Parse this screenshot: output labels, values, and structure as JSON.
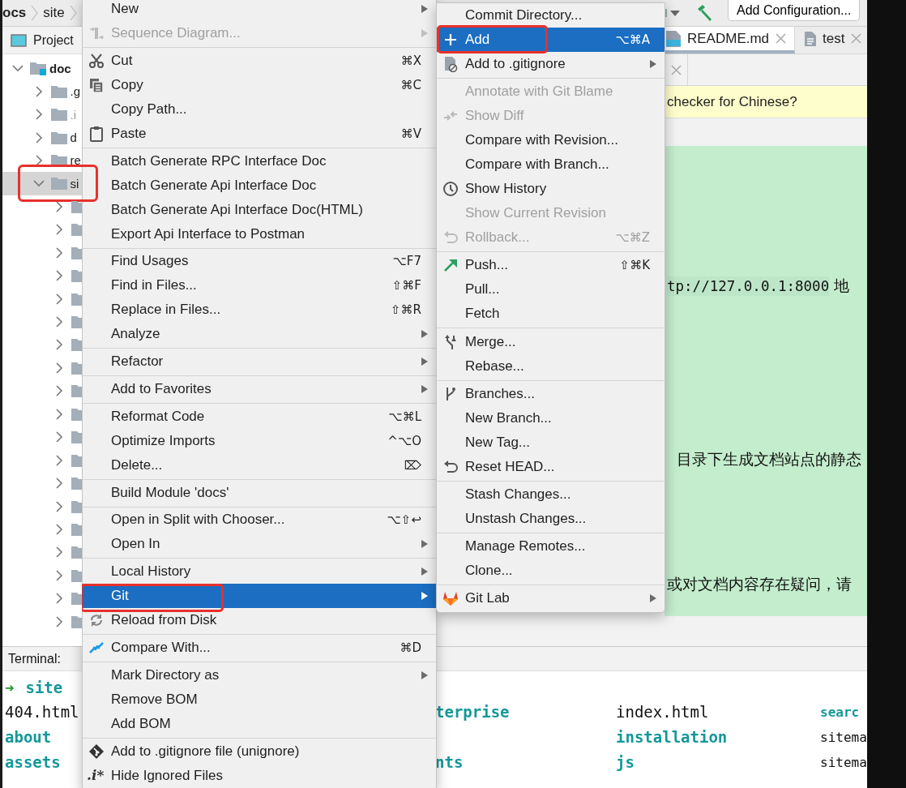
{
  "breadcrumbs": [
    {
      "label": "ocs",
      "bold": true
    },
    {
      "label": "site",
      "bold": false
    }
  ],
  "toolbar": {
    "button": "Add Configuration..."
  },
  "project_panel": {
    "title": "Project"
  },
  "tree": {
    "label": "doc",
    "expanded": true,
    "selected": false,
    "highlighted": false,
    "children": [
      {
        "label": ".g",
        "expanded": false,
        "selected": false,
        "highlighted": false,
        "ignored": false
      },
      {
        "label": ".i",
        "expanded": false,
        "selected": false,
        "highlighted": false,
        "ignored": true
      },
      {
        "label": "d",
        "expanded": false,
        "selected": false,
        "highlighted": false,
        "ignored": false
      },
      {
        "label": "re",
        "expanded": false,
        "selected": false,
        "highlighted": false,
        "ignored": false
      },
      {
        "label": "si",
        "expanded": true,
        "selected": true,
        "highlighted": true,
        "ignored": false,
        "children": [
          {
            "expanded": false,
            "selected": false
          },
          {
            "expanded": false,
            "selected": false
          },
          {
            "expanded": false,
            "selected": false
          },
          {
            "expanded": false,
            "selected": false
          },
          {
            "expanded": false,
            "selected": false
          },
          {
            "expanded": false,
            "selected": false
          },
          {
            "expanded": false,
            "selected": false
          },
          {
            "expanded": false,
            "selected": false
          },
          {
            "expanded": false,
            "selected": false
          },
          {
            "expanded": false,
            "selected": false
          },
          {
            "expanded": false,
            "selected": false
          },
          {
            "expanded": false,
            "selected": false
          },
          {
            "expanded": false,
            "selected": false
          },
          {
            "expanded": false,
            "selected": false
          },
          {
            "expanded": false,
            "selected": false
          },
          {
            "expanded": false,
            "selected": false
          },
          {
            "expanded": false,
            "selected": false
          },
          {
            "expanded": false,
            "selected": false
          },
          {
            "expanded": false,
            "selected": false
          }
        ]
      }
    ]
  },
  "editor": {
    "tabs": [
      {
        "label": "README.md",
        "kind": "markdown",
        "selected": true
      },
      {
        "label": "test",
        "kind": "text",
        "selected": false
      }
    ],
    "notification": "checker for Chinese?",
    "lines": [
      {
        "kind": "code",
        "code": "tp://127.0.0.1:8000",
        "text": "地"
      },
      {
        "kind": "text",
        "text": "目录下生成文档站点的静态"
      },
      {
        "kind": "text",
        "text": "或对文档内容存在疑问，请"
      }
    ]
  },
  "terminal": {
    "title": "Terminal:",
    "prompt_arrow": "➜",
    "prompt_dir": "site",
    "columns": [
      [
        {
          "text": "404.html",
          "kind": "file"
        },
        {
          "text": "about",
          "kind": "dir"
        },
        {
          "text": "assets",
          "kind": "dir"
        }
      ],
      [
        {
          "text": "terprise",
          "kind": "dir"
        },
        {
          "text": "nts",
          "kind": "dir"
        }
      ],
      [
        {
          "text": "index.html",
          "kind": "file"
        },
        {
          "text": "installation",
          "kind": "dir"
        },
        {
          "text": "js",
          "kind": "dir"
        }
      ],
      [
        {
          "text": "searc",
          "kind": "dir"
        },
        {
          "text": "sitema",
          "kind": "file"
        },
        {
          "text": "sitema",
          "kind": "file"
        }
      ]
    ]
  },
  "context_menu": {
    "items": [
      {
        "kind": "item",
        "label": "New",
        "submenu": true,
        "disabled": false,
        "selected": false,
        "highlighted": false
      },
      {
        "kind": "item",
        "label": "Sequence Diagram...",
        "submenu": true,
        "disabled": true,
        "selected": false,
        "highlighted": false
      },
      {
        "kind": "separator"
      },
      {
        "kind": "item",
        "label": "Cut",
        "shortcut": "⌘X",
        "submenu": false,
        "disabled": false,
        "selected": false,
        "highlighted": false
      },
      {
        "kind": "item",
        "label": "Copy",
        "shortcut": "⌘C",
        "submenu": false,
        "disabled": false,
        "selected": false,
        "highlighted": false
      },
      {
        "kind": "item",
        "label": "Copy Path...",
        "submenu": false,
        "disabled": false,
        "selected": false,
        "highlighted": false
      },
      {
        "kind": "item",
        "label": "Paste",
        "shortcut": "⌘V",
        "submenu": false,
        "disabled": false,
        "selected": false,
        "highlighted": false
      },
      {
        "kind": "separator"
      },
      {
        "kind": "item",
        "label": "Batch Generate RPC Interface Doc",
        "submenu": false,
        "disabled": false,
        "selected": false,
        "highlighted": false
      },
      {
        "kind": "item",
        "label": "Batch Generate Api Interface Doc",
        "submenu": false,
        "disabled": false,
        "selected": false,
        "highlighted": false
      },
      {
        "kind": "item",
        "label": "Batch Generate Api Interface Doc(HTML)",
        "submenu": false,
        "disabled": false,
        "selected": false,
        "highlighted": false
      },
      {
        "kind": "item",
        "label": "Export Api Interface to Postman",
        "submenu": false,
        "disabled": false,
        "selected": false,
        "highlighted": false
      },
      {
        "kind": "separator"
      },
      {
        "kind": "item",
        "label": "Find Usages",
        "shortcut": "⌥F7",
        "submenu": false,
        "disabled": false,
        "selected": false,
        "highlighted": false
      },
      {
        "kind": "item",
        "label": "Find in Files...",
        "shortcut": "⇧⌘F",
        "submenu": false,
        "disabled": false,
        "selected": false,
        "highlighted": false
      },
      {
        "kind": "item",
        "label": "Replace in Files...",
        "shortcut": "⇧⌘R",
        "submenu": false,
        "disabled": false,
        "selected": false,
        "highlighted": false
      },
      {
        "kind": "item",
        "label": "Analyze",
        "submenu": true,
        "disabled": false,
        "selected": false,
        "highlighted": false
      },
      {
        "kind": "separator"
      },
      {
        "kind": "item",
        "label": "Refactor",
        "submenu": true,
        "disabled": false,
        "selected": false,
        "highlighted": false
      },
      {
        "kind": "separator"
      },
      {
        "kind": "item",
        "label": "Add to Favorites",
        "submenu": true,
        "disabled": false,
        "selected": false,
        "highlighted": false
      },
      {
        "kind": "separator"
      },
      {
        "kind": "item",
        "label": "Reformat Code",
        "shortcut": "⌥⌘L",
        "submenu": false,
        "disabled": false,
        "selected": false,
        "highlighted": false
      },
      {
        "kind": "item",
        "label": "Optimize Imports",
        "shortcut": "^⌥O",
        "submenu": false,
        "disabled": false,
        "selected": false,
        "highlighted": false
      },
      {
        "kind": "item",
        "label": "Delete...",
        "shortcut": "⌦",
        "submenu": false,
        "disabled": false,
        "selected": false,
        "highlighted": false
      },
      {
        "kind": "separator"
      },
      {
        "kind": "item",
        "label": "Build Module 'docs'",
        "submenu": false,
        "disabled": false,
        "selected": false,
        "highlighted": false
      },
      {
        "kind": "separator"
      },
      {
        "kind": "item",
        "label": "Open in Split with Chooser...",
        "shortcut": "⌥⇧↩",
        "submenu": false,
        "disabled": false,
        "selected": false,
        "highlighted": false
      },
      {
        "kind": "item",
        "label": "Open In",
        "submenu": true,
        "disabled": false,
        "selected": false,
        "highlighted": false
      },
      {
        "kind": "separator"
      },
      {
        "kind": "item",
        "label": "Local History",
        "submenu": true,
        "disabled": false,
        "selected": false,
        "highlighted": false
      },
      {
        "kind": "item",
        "label": "Git",
        "submenu": true,
        "disabled": false,
        "selected": true,
        "highlighted": true
      },
      {
        "kind": "item",
        "label": "Reload from Disk",
        "submenu": false,
        "disabled": false,
        "selected": false,
        "highlighted": false
      },
      {
        "kind": "separator"
      },
      {
        "kind": "item",
        "label": "Compare With...",
        "shortcut": "⌘D",
        "submenu": false,
        "disabled": false,
        "selected": false,
        "highlighted": false
      },
      {
        "kind": "separator"
      },
      {
        "kind": "item",
        "label": "Mark Directory as",
        "submenu": true,
        "disabled": false,
        "selected": false,
        "highlighted": false
      },
      {
        "kind": "item",
        "label": "Remove BOM",
        "submenu": false,
        "disabled": false,
        "selected": false,
        "highlighted": false
      },
      {
        "kind": "item",
        "label": "Add BOM",
        "submenu": false,
        "disabled": false,
        "selected": false,
        "highlighted": false
      },
      {
        "kind": "separator"
      },
      {
        "kind": "item",
        "label": "Add to .gitignore file (unignore)",
        "submenu": false,
        "disabled": false,
        "selected": false,
        "highlighted": false
      },
      {
        "kind": "item",
        "label": "Hide Ignored Files",
        "glyph": ".i*",
        "submenu": false,
        "disabled": false,
        "selected": false,
        "highlighted": false
      }
    ]
  },
  "git_submenu": {
    "items": [
      {
        "kind": "item",
        "label": "Commit Directory...",
        "submenu": false,
        "disabled": false,
        "selected": false,
        "highlighted": false
      },
      {
        "kind": "item",
        "label": "Add",
        "shortcut": "⌥⌘A",
        "submenu": false,
        "disabled": false,
        "selected": true,
        "highlighted": true
      },
      {
        "kind": "item",
        "label": "Add to .gitignore",
        "submenu": true,
        "disabled": false,
        "selected": false,
        "highlighted": false
      },
      {
        "kind": "separator"
      },
      {
        "kind": "item",
        "label": "Annotate with Git Blame",
        "submenu": false,
        "disabled": true,
        "selected": false,
        "highlighted": false
      },
      {
        "kind": "item",
        "label": "Show Diff",
        "submenu": false,
        "disabled": true,
        "selected": false,
        "highlighted": false
      },
      {
        "kind": "item",
        "label": "Compare with Revision...",
        "submenu": false,
        "disabled": false,
        "selected": false,
        "highlighted": false
      },
      {
        "kind": "item",
        "label": "Compare with Branch...",
        "submenu": false,
        "disabled": false,
        "selected": false,
        "highlighted": false
      },
      {
        "kind": "item",
        "label": "Show History",
        "submenu": false,
        "disabled": false,
        "selected": false,
        "highlighted": false
      },
      {
        "kind": "item",
        "label": "Show Current Revision",
        "submenu": false,
        "disabled": true,
        "selected": false,
        "highlighted": false
      },
      {
        "kind": "item",
        "label": "Rollback...",
        "shortcut": "⌥⌘Z",
        "submenu": false,
        "disabled": true,
        "selected": false,
        "highlighted": false
      },
      {
        "kind": "separator"
      },
      {
        "kind": "item",
        "label": "Push...",
        "shortcut": "⇧⌘K",
        "submenu": false,
        "disabled": false,
        "selected": false,
        "highlighted": false
      },
      {
        "kind": "item",
        "label": "Pull...",
        "submenu": false,
        "disabled": false,
        "selected": false,
        "highlighted": false
      },
      {
        "kind": "item",
        "label": "Fetch",
        "submenu": false,
        "disabled": false,
        "selected": false,
        "highlighted": false
      },
      {
        "kind": "separator"
      },
      {
        "kind": "item",
        "label": "Merge...",
        "submenu": false,
        "disabled": false,
        "selected": false,
        "highlighted": false
      },
      {
        "kind": "item",
        "label": "Rebase...",
        "submenu": false,
        "disabled": false,
        "selected": false,
        "highlighted": false
      },
      {
        "kind": "separator"
      },
      {
        "kind": "item",
        "label": "Branches...",
        "submenu": false,
        "disabled": false,
        "selected": false,
        "highlighted": false
      },
      {
        "kind": "item",
        "label": "New Branch...",
        "submenu": false,
        "disabled": false,
        "selected": false,
        "highlighted": false
      },
      {
        "kind": "item",
        "label": "New Tag...",
        "submenu": false,
        "disabled": false,
        "selected": false,
        "highlighted": false
      },
      {
        "kind": "item",
        "label": "Reset HEAD...",
        "submenu": false,
        "disabled": false,
        "selected": false,
        "highlighted": false
      },
      {
        "kind": "separator"
      },
      {
        "kind": "item",
        "label": "Stash Changes...",
        "submenu": false,
        "disabled": false,
        "selected": false,
        "highlighted": false
      },
      {
        "kind": "item",
        "label": "Unstash Changes...",
        "submenu": false,
        "disabled": false,
        "selected": false,
        "highlighted": false
      },
      {
        "kind": "separator"
      },
      {
        "kind": "item",
        "label": "Manage Remotes...",
        "submenu": false,
        "disabled": false,
        "selected": false,
        "highlighted": false
      },
      {
        "kind": "item",
        "label": "Clone...",
        "submenu": false,
        "disabled": false,
        "selected": false,
        "highlighted": false
      },
      {
        "kind": "separator"
      },
      {
        "kind": "item",
        "label": "Git Lab",
        "submenu": true,
        "disabled": false,
        "selected": false,
        "highlighted": false
      }
    ]
  }
}
